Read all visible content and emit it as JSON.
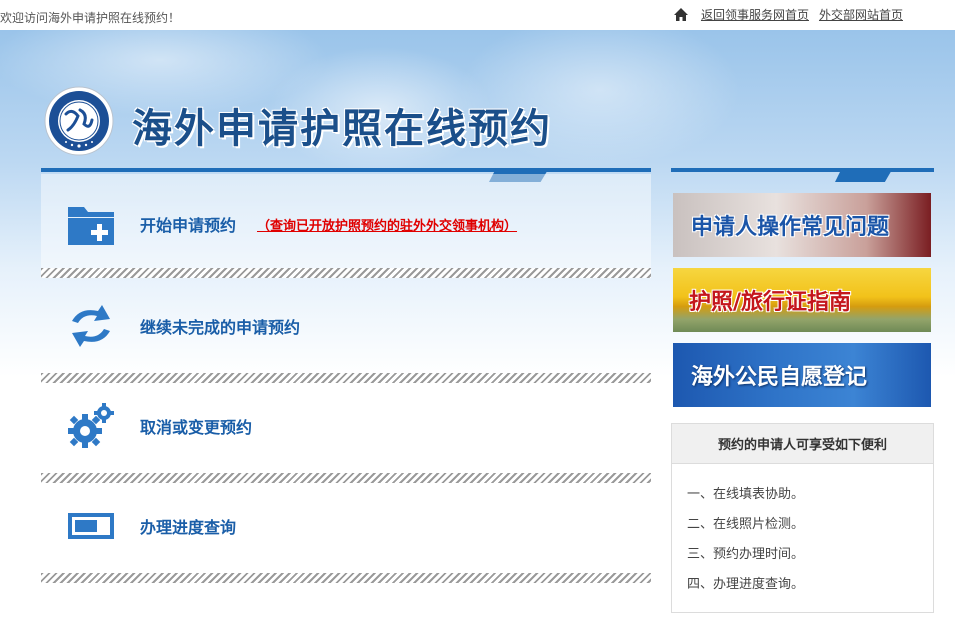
{
  "topbar": {
    "welcome": "欢迎访问海外申请护照在线预约！",
    "links": [
      "返回领事服务网首页",
      "外交部网站首页"
    ]
  },
  "header": {
    "title": "海外申请护照在线预约",
    "logo_icon": "consular-affairs-emblem"
  },
  "main": {
    "items": [
      {
        "label": "开始申请预约",
        "note": "（查询已开放护照预约的驻外外交领事机构）",
        "icon": "folder-add-icon"
      },
      {
        "label": "继续未完成的申请预约",
        "icon": "refresh-arrows-icon"
      },
      {
        "label": "取消或变更预约",
        "icon": "gear-icon"
      },
      {
        "label": "办理进度查询",
        "icon": "progress-window-icon"
      }
    ]
  },
  "sidebar": {
    "promos": [
      "申请人操作常见问题",
      "护照/旅行证指南",
      "海外公民自愿登记"
    ],
    "benefits": {
      "title": "预约的申请人可享受如下便利",
      "items": [
        "一、在线填表协助。",
        "二、在线照片检测。",
        "三、预约办理时间。",
        "四、办理进度查询。"
      ]
    }
  },
  "colors": {
    "accent": "#1f6db8",
    "link_text": "#1a5ea8",
    "warning": "#e00000"
  }
}
